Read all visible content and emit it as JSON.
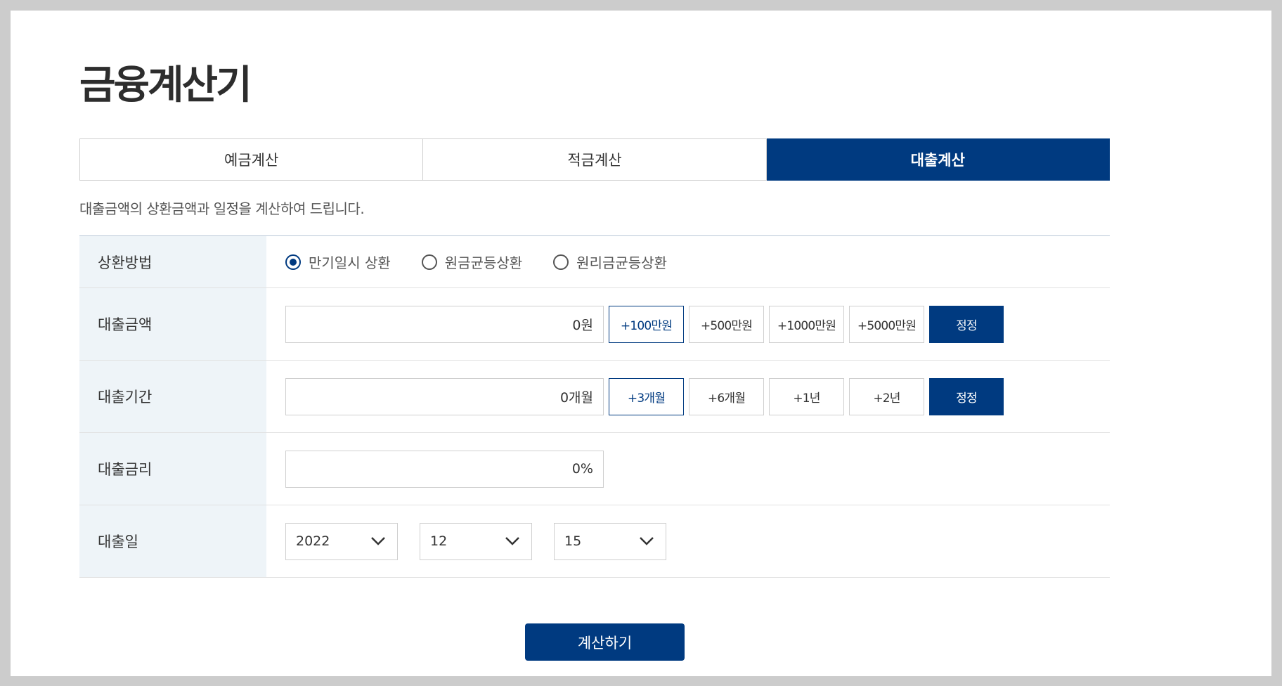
{
  "page_title": "금융계산기",
  "tabs": [
    {
      "label": "예금계산",
      "active": false
    },
    {
      "label": "적금계산",
      "active": false
    },
    {
      "label": "대출계산",
      "active": true
    }
  ],
  "description": "대출금액의 상환금액과 일정을 계산하여 드립니다.",
  "form": {
    "repayment": {
      "label": "상환방법",
      "options": [
        {
          "label": "만기일시 상환",
          "checked": true
        },
        {
          "label": "원금균등상환",
          "checked": false
        },
        {
          "label": "원리금균등상환",
          "checked": false
        }
      ]
    },
    "amount": {
      "label": "대출금액",
      "value": "0원",
      "buttons": [
        "+100만원",
        "+500만원",
        "+1000만원",
        "+5000만원"
      ],
      "reset_label": "정정"
    },
    "period": {
      "label": "대출기간",
      "value": "0개월",
      "buttons": [
        "+3개월",
        "+6개월",
        "+1년",
        "+2년"
      ],
      "reset_label": "정정"
    },
    "rate": {
      "label": "대출금리",
      "value": "0%"
    },
    "date": {
      "label": "대출일",
      "year": "2022",
      "month": "12",
      "day": "15"
    }
  },
  "calculate_label": "계산하기",
  "colors": {
    "accent": "#003a80",
    "label_bg": "#eef4f8",
    "page_bg": "#cccccc"
  },
  "icons": {
    "radio_checked": "radio-checked-icon",
    "radio_unchecked": "radio-unchecked-icon",
    "select_arrow": "chevron-down-icon"
  }
}
